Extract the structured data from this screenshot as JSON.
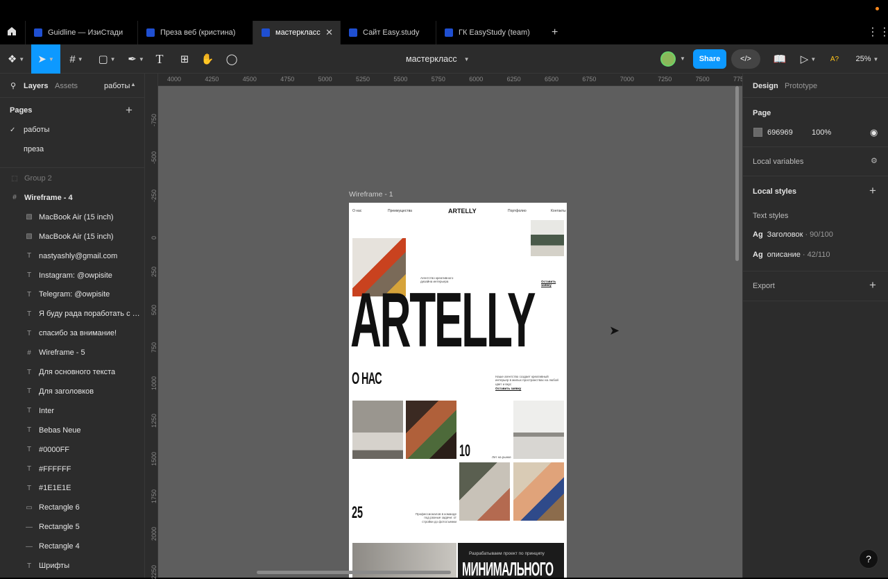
{
  "tabs": [
    {
      "label": "Guidline — ИзиСтади",
      "active": false
    },
    {
      "label": "Преза веб (кристина)",
      "active": false
    },
    {
      "label": "мастеркласс",
      "active": true
    },
    {
      "label": "Сайт Easy.study",
      "active": false
    },
    {
      "label": "ГК EasyStudy (team)",
      "active": false
    }
  ],
  "toolbar": {
    "file_name": "мастеркласс",
    "share": "Share",
    "zoom": "25%",
    "a_label": "A?"
  },
  "left": {
    "tab_layers": "Layers",
    "tab_assets": "Assets",
    "current_page": "работы",
    "pages_title": "Pages",
    "pages": [
      "работы",
      "преза"
    ],
    "layers": [
      {
        "name": "Group 2",
        "icon": "group-icon",
        "dim": true
      },
      {
        "name": "Wireframe - 4",
        "icon": "frame-icon",
        "bold": true
      },
      {
        "name": "MacBook Air (15 inch)",
        "icon": "image-icon"
      },
      {
        "name": "MacBook Air (15 inch)",
        "icon": "image-icon"
      },
      {
        "name": "nastyashly@gmail.com",
        "icon": "text-icon"
      },
      {
        "name": "Instagram: @owpisite",
        "icon": "text-icon"
      },
      {
        "name": "Telegram: @owpisite",
        "icon": "text-icon"
      },
      {
        "name": "Я буду рада поработать с вами!",
        "icon": "text-icon"
      },
      {
        "name": "спасибо за внимание!",
        "icon": "text-icon"
      },
      {
        "name": "Wireframe - 5",
        "icon": "frame-icon"
      },
      {
        "name": "Для основного текста",
        "icon": "text-icon"
      },
      {
        "name": "Для заголовков",
        "icon": "text-icon"
      },
      {
        "name": "Inter",
        "icon": "text-icon"
      },
      {
        "name": "Bebas Neue",
        "icon": "text-icon"
      },
      {
        "name": "#0000FF",
        "icon": "text-icon"
      },
      {
        "name": "#FFFFFF",
        "icon": "text-icon"
      },
      {
        "name": "#1E1E1E",
        "icon": "text-icon"
      },
      {
        "name": "Rectangle 6",
        "icon": "rect-icon"
      },
      {
        "name": "Rectangle 5",
        "icon": "line-icon"
      },
      {
        "name": "Rectangle 4",
        "icon": "line-icon"
      },
      {
        "name": "Шрифты",
        "icon": "text-icon"
      }
    ]
  },
  "ruler_top": [
    "4000",
    "4250",
    "4500",
    "4750",
    "5000",
    "5250",
    "5500",
    "5750",
    "6000",
    "6250",
    "6500",
    "6750",
    "7000",
    "7250",
    "7500",
    "775"
  ],
  "ruler_left": [
    "-750",
    "-500",
    "-250",
    "0",
    "250",
    "500",
    "750",
    "1000",
    "1250",
    "1500",
    "1750",
    "2000",
    "2250"
  ],
  "canvas": {
    "frame_label": "Wireframe - 1",
    "site": {
      "nav": [
        "О нас",
        "Преимущества",
        "Портфолио",
        "Контакты"
      ],
      "logo": "ARTELLY",
      "hero": "ARTELLY",
      "tagline": "Агентство креативного дизайна интерьера",
      "cta": "Оставить заявку",
      "about_title": "О НАС",
      "about_text": "Наше агентство создает креативный интерьер в жилых пространствах на любой цвет и вкус",
      "about_cta": "Оставить заявку",
      "num1": "10",
      "num1_text": "Лет на рынке",
      "num2": "25",
      "num2_text": "Профессионалов в команде под разные задачи: от стройки до фотосъемки",
      "bottom_small": "Разрабатываем проект по принципу",
      "bottom_big": "МИНИМАЛЬНОГО"
    }
  },
  "right": {
    "tab_design": "Design",
    "tab_prototype": "Prototype",
    "page_title": "Page",
    "page_color": "696969",
    "page_opacity": "100%",
    "local_variables": "Local variables",
    "local_styles": "Local styles",
    "text_styles": "Text styles",
    "styles": [
      {
        "name": "Заголовок",
        "meta": " · 90/100"
      },
      {
        "name": "описание",
        "meta": " · 42/110"
      }
    ],
    "export": "Export"
  },
  "colors": {
    "accent": "#0d99ff",
    "canvas": "#5e5e5e",
    "panel": "#2c2c2c",
    "page_swatch": "#696969"
  }
}
